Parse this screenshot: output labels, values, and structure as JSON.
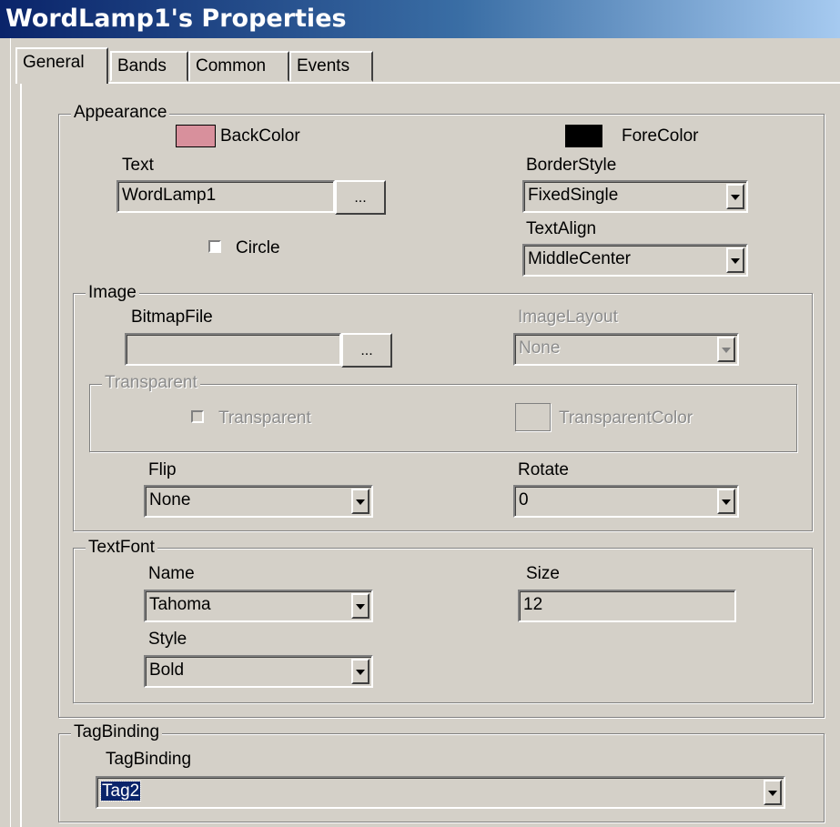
{
  "window": {
    "title": "WordLamp1's Properties"
  },
  "tabs": [
    {
      "label": "General",
      "active": true
    },
    {
      "label": "Bands",
      "active": false
    },
    {
      "label": "Common",
      "active": false
    },
    {
      "label": "Events",
      "active": false
    }
  ],
  "appearance": {
    "legend": "Appearance",
    "backcolor_label": "BackColor",
    "backcolor_value": "#d8909c",
    "forecolor_label": "ForeColor",
    "forecolor_value": "#000000",
    "text_label": "Text",
    "text_value": "WordLamp1",
    "browse_label": "...",
    "circle_label": "Circle",
    "circle_checked": false,
    "borderstyle_label": "BorderStyle",
    "borderstyle_value": "FixedSingle",
    "textalign_label": "TextAlign",
    "textalign_value": "MiddleCenter"
  },
  "image": {
    "legend": "Image",
    "bitmapfile_label": "BitmapFile",
    "bitmapfile_value": "",
    "browse_label": "...",
    "imagelayout_label": "ImageLayout",
    "imagelayout_value": "None",
    "transparent_group": {
      "legend": "Transparent",
      "checkbox_label": "Transparent",
      "color_label": "TransparentColor"
    },
    "flip_label": "Flip",
    "flip_value": "None",
    "rotate_label": "Rotate",
    "rotate_value": "0"
  },
  "textfont": {
    "legend": "TextFont",
    "name_label": "Name",
    "name_value": "Tahoma",
    "size_label": "Size",
    "size_value": "12",
    "style_label": "Style",
    "style_value": "Bold"
  },
  "tagbinding": {
    "legend": "TagBinding",
    "label": "TagBinding",
    "value": "Tag2"
  }
}
